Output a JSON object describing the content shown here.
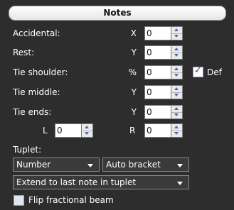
{
  "title": "Notes",
  "rows": [
    {
      "label": "Accidental:",
      "axis": "X",
      "value": "0"
    },
    {
      "label": "Rest:",
      "axis": "Y",
      "value": "0"
    },
    {
      "label": "Tie shoulder:",
      "axis": "%",
      "value": "0"
    },
    {
      "label": "Tie middle:",
      "axis": "Y",
      "value": "0"
    },
    {
      "label": "Tie ends:",
      "axis": "Y",
      "value": "0"
    }
  ],
  "def_checkbox": {
    "label": "Def",
    "checked": true
  },
  "tie_ends_lr": {
    "l_label": "L",
    "l_value": "0",
    "r_label": "R",
    "r_value": "0"
  },
  "tuplet": {
    "label": "Tuplet:",
    "number_select": "Number",
    "bracket_select": "Auto bracket",
    "extend_select": "Extend to last note in tuplet"
  },
  "flip": {
    "label": "Flip fractional beam",
    "checked": false
  }
}
